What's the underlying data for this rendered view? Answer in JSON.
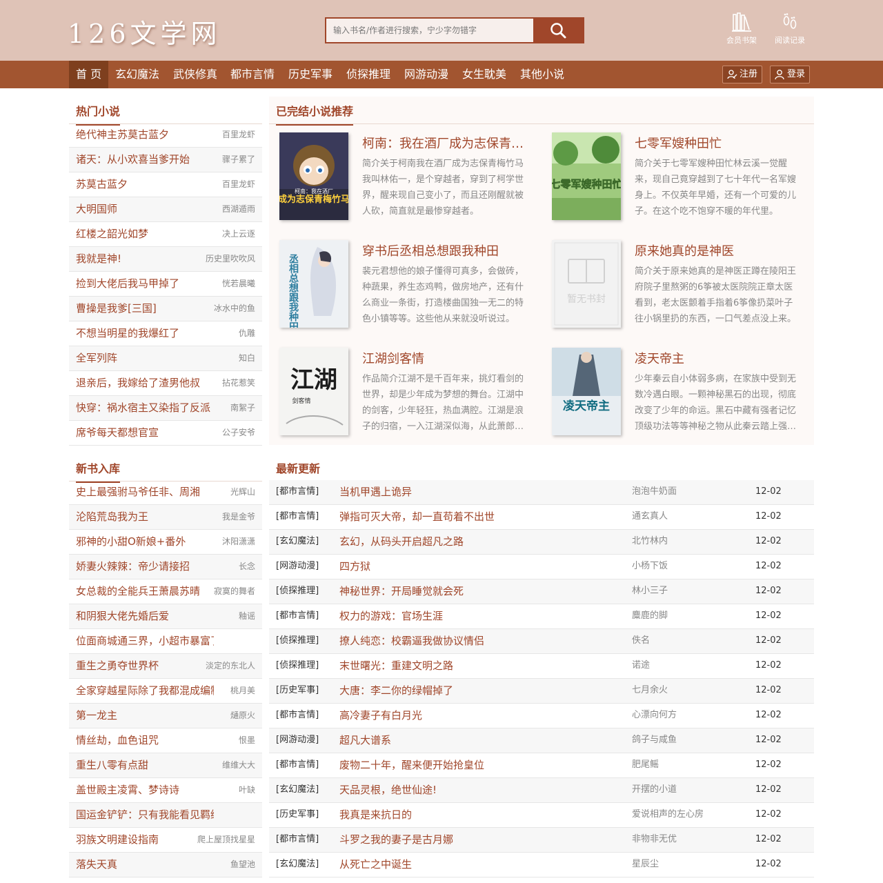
{
  "site": {
    "logo": "126文学网"
  },
  "search": {
    "placeholder": "输入书名/作者进行搜索，宁少字勿错字"
  },
  "tools": {
    "shelf": "会员书架",
    "history": "阅读记录"
  },
  "nav": [
    "首 页",
    "玄幻魔法",
    "武侠修真",
    "都市言情",
    "历史军事",
    "侦探推理",
    "网游动漫",
    "女生耽美",
    "其他小说"
  ],
  "account": {
    "register": "注册",
    "login": "登录"
  },
  "hot": {
    "title": "热门小说",
    "items": [
      {
        "t": "绝代神主苏莫古蓝夕",
        "a": "百里龙虾"
      },
      {
        "t": "诸天：从小欢喜当爹开始",
        "a": "骤子累了"
      },
      {
        "t": "苏莫古蓝夕",
        "a": "百里龙虾"
      },
      {
        "t": "大明国师",
        "a": "西湖遁雨"
      },
      {
        "t": "红楼之韶光如梦",
        "a": "决上云逐"
      },
      {
        "t": "我就是神!",
        "a": "历史里吹吹风"
      },
      {
        "t": "捡到大佬后我马甲掉了",
        "a": "恍若晨曦"
      },
      {
        "t": "曹操是我爹[三国]",
        "a": "冰水中的鱼"
      },
      {
        "t": "不想当明星的我爆红了",
        "a": "仇雕"
      },
      {
        "t": "全军列阵",
        "a": "知白"
      },
      {
        "t": "退亲后，我嫁给了渣男他叔",
        "a": "拈花惹笑"
      },
      {
        "t": "快穿：祸水宿主又染指了反派",
        "a": "南絮子"
      },
      {
        "t": "席爷每天都想官宣",
        "a": "公子安爷"
      }
    ]
  },
  "recommend": {
    "title": "已完结小说推荐",
    "books": [
      {
        "title": "柯南：我在酒厂成为志保青梅竹马",
        "desc": "简介关于柯南我在酒厂成为志保青梅竹马我叫林佑一，是个穿越者，穿到了柯学世界，醒来现自己变小了，而且还刚醒就被人砍，简直就是最惨穿越者。",
        "cover_text": "成为志保青梅竹马",
        "cover_sub": "柯南：我在酒厂"
      },
      {
        "title": "七零军嫂种田忙",
        "desc": "简介关于七零军嫂种田忙林云溪一觉醒来，现自己竟穿越到了七十年代一名军嫂身上。不仅英年早婚，还有一个可爱的儿子。在这个吃不饱穿不暖的年代里。",
        "cover_text": "七零军嫂种田忙"
      },
      {
        "title": "穿书后丞相总想跟我种田",
        "desc": "裴元君想他的娘子懂得可真多，会做砖，种蔬果，养生态鸡鸭，做房地产，还有什么商业一条街，打造楼曲国独一无二的特色小镇等等。这些他从来就没听说过。",
        "cover_text": "丞相总想跟我种田"
      },
      {
        "title": "原来她真的是神医",
        "desc": "简介关于原来她真的是神医正蹲在陵阳王府院子里熬粥的6筝被太医院院正章太医看到，老太医颤着手指着6筝像扔菜叶子往小锅里扔的东西，一口气差点没上来。",
        "cover_text": "暂无书封"
      },
      {
        "title": "江湖剑客情",
        "desc": "作品简介江湖不是千百年来，挑灯看剑的世界，却是少年成为梦想的舞台。江湖中的剑客，少年轻狂，热血满腔。江湖是浪子的归宿，一入江湖深似海，从此萧郎是路人。",
        "cover_text": "江湖",
        "cover_sub": "剑客情"
      },
      {
        "title": "凌天帝主",
        "desc": "少年秦云自小体弱多病，在家族中受到无数冷遇白眼。一颗神秘黑石的出现，彻底改变了少年的命运。黑石中藏有强者记忆顶级功法等等神秘之物从此秦云踏上强者之路。",
        "cover_text": "凌天帝主"
      }
    ]
  },
  "newbooks": {
    "title": "新书入库",
    "items": [
      {
        "t": "史上最强驸马爷任非、周湘",
        "a": "光辉山"
      },
      {
        "t": "沦陷荒岛我为王",
        "a": "我是金爷"
      },
      {
        "t": "邪神的小甜O新娘+番外",
        "a": "沐阳潇潇"
      },
      {
        "t": "娇妻火辣辣：帝少请接招",
        "a": "长念"
      },
      {
        "t": "女总裁的全能兵王萧晨苏晴",
        "a": "寂寞的舞者"
      },
      {
        "t": "和阴狠大佬先婚后爱",
        "a": "釉谣"
      },
      {
        "t": "位面商城通三界，小超市暴富了",
        "a": ""
      },
      {
        "t": "重生之勇夺世界杯",
        "a": "淡定的东北人"
      },
      {
        "t": "全家穿越星际除了我都混成编制",
        "a": "桃月美"
      },
      {
        "t": "第一龙主",
        "a": "熥原火"
      },
      {
        "t": "情丝劫，血色诅咒",
        "a": "恨墨"
      },
      {
        "t": "重生八零有点甜",
        "a": "维维大大"
      },
      {
        "t": "盖世殿主凌霄、梦诗诗",
        "a": "叶缺"
      },
      {
        "t": "国运金铲铲：只有我能看见羁绊",
        "a": ""
      },
      {
        "t": "羽族文明建设指南",
        "a": "爬上屋顶找星星"
      },
      {
        "t": "落失天真",
        "a": "鱼望池"
      }
    ]
  },
  "updates": {
    "title": "最新更新",
    "items": [
      {
        "c": "[都市言情]",
        "n": "当机甲遇上诡异",
        "a": "泡泡牛奶面",
        "d": "12-02"
      },
      {
        "c": "[都市言情]",
        "n": "弹指可灭大帝，却一直苟着不出世",
        "a": "通玄真人",
        "d": "12-02"
      },
      {
        "c": "[玄幻魔法]",
        "n": "玄幻，从码头开启超凡之路",
        "a": "北竹林内",
        "d": "12-02"
      },
      {
        "c": "[网游动漫]",
        "n": "四方狱",
        "a": "小杨下饭",
        "d": "12-02"
      },
      {
        "c": "[侦探推理]",
        "n": "神秘世界：开局睡觉就会死",
        "a": "林小三子",
        "d": "12-02"
      },
      {
        "c": "[都市言情]",
        "n": "权力的游戏：官场生涯",
        "a": "麋鹿的脚",
        "d": "12-02"
      },
      {
        "c": "[侦探推理]",
        "n": "撩人纯恋：校霸逼我做协议情侣",
        "a": "佚名",
        "d": "12-02"
      },
      {
        "c": "[侦探推理]",
        "n": "末世曙光：重建文明之路",
        "a": "诺途",
        "d": "12-02"
      },
      {
        "c": "[历史军事]",
        "n": "大唐：李二你的绿帽掉了",
        "a": "七月余火",
        "d": "12-02"
      },
      {
        "c": "[都市言情]",
        "n": "高冷妻子有白月光",
        "a": "心漂向何方",
        "d": "12-02"
      },
      {
        "c": "[网游动漫]",
        "n": "超凡大谱系",
        "a": "鸽子与咸鱼",
        "d": "12-02"
      },
      {
        "c": "[都市言情]",
        "n": "废物二十年，醒来便开始抢皇位",
        "a": "肥尾鳐",
        "d": "12-02"
      },
      {
        "c": "[玄幻魔法]",
        "n": "天品灵根，绝世仙途!",
        "a": "开摆的小道",
        "d": "12-02"
      },
      {
        "c": "[历史军事]",
        "n": "我真是来抗日的",
        "a": "爱说相声的左心房",
        "d": "12-02"
      },
      {
        "c": "[都市言情]",
        "n": "斗罗之我的妻子是古月娜",
        "a": "非物非无优",
        "d": "12-02"
      },
      {
        "c": "[玄幻魔法]",
        "n": "从死亡之中诞生",
        "a": "星辰尘",
        "d": "12-02"
      }
    ]
  },
  "colors": {
    "accent": "#a0462a",
    "nav_bg": "#a25530",
    "header_bg": "#dfc3b7"
  }
}
